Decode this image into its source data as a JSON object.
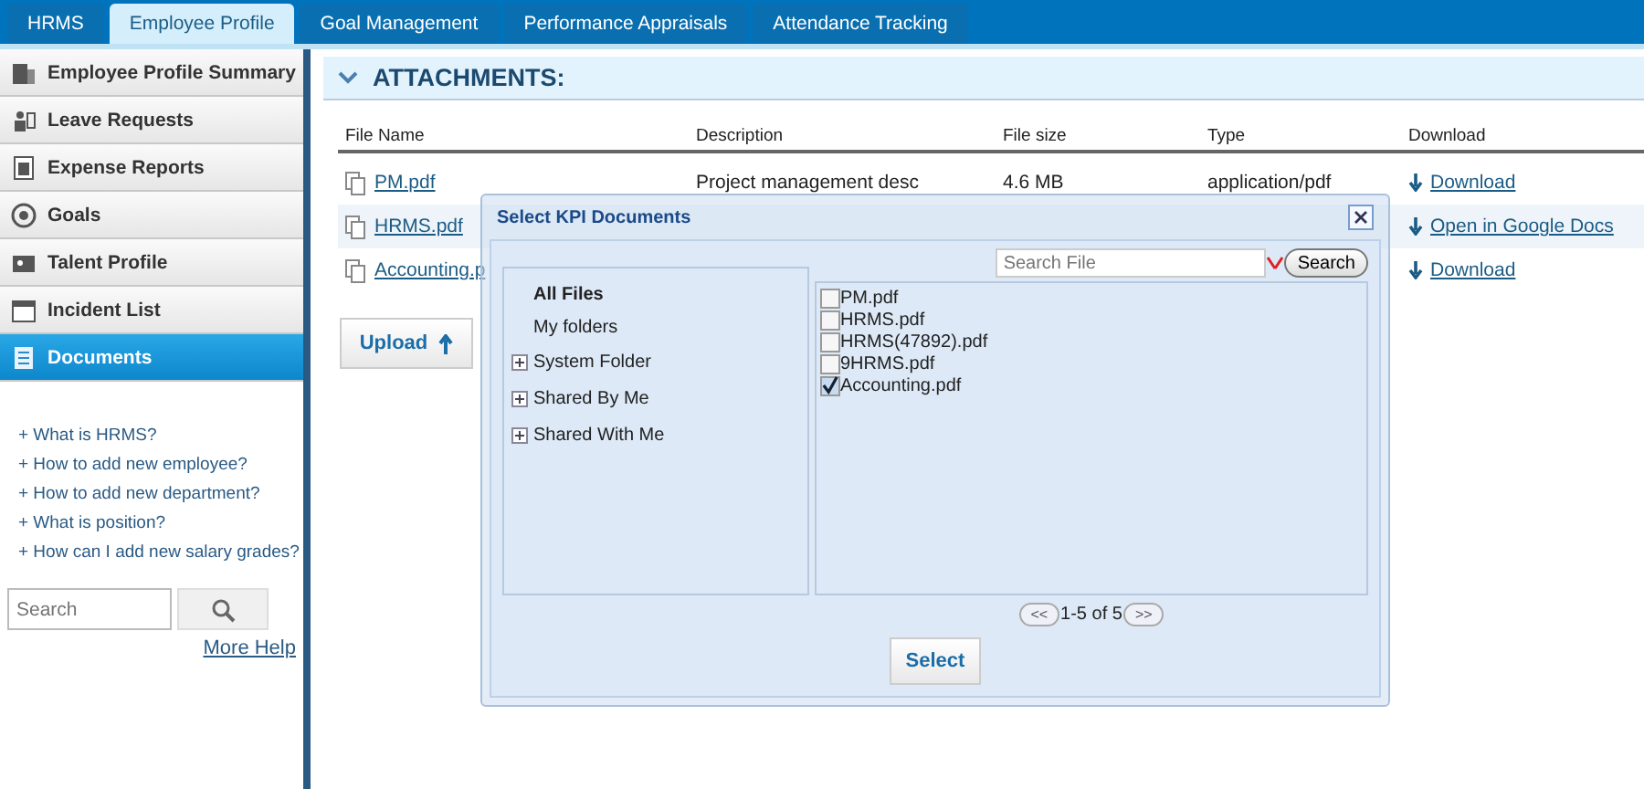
{
  "tabs": [
    {
      "label": "HRMS",
      "selected": false
    },
    {
      "label": "Employee Profile",
      "selected": true
    },
    {
      "label": "Goal Management",
      "selected": false
    },
    {
      "label": "Performance Appraisals",
      "selected": false
    },
    {
      "label": "Attendance Tracking",
      "selected": false
    }
  ],
  "sidebar": {
    "items": [
      {
        "label": "Employee Profile Summary",
        "selected": false
      },
      {
        "label": "Leave Requests",
        "selected": false
      },
      {
        "label": "Expense Reports",
        "selected": false
      },
      {
        "label": "Goals",
        "selected": false
      },
      {
        "label": "Talent Profile",
        "selected": false
      },
      {
        "label": "Incident List",
        "selected": false
      },
      {
        "label": "Documents",
        "selected": true
      }
    ],
    "help_links": [
      "+ What is HRMS?",
      "+ How to add new employee?",
      "+ How to add new department?",
      "+ What is position?",
      "+ How can I add new salary grades?"
    ],
    "search": {
      "placeholder": "Search"
    },
    "more_help": "More Help"
  },
  "section": {
    "title": "ATTACHMENTS:",
    "expanded": true
  },
  "table": {
    "columns": [
      "File Name",
      "Description",
      "File size",
      "Type",
      "Download"
    ],
    "rows": [
      {
        "file": "PM.pdf",
        "description": "Project management desc",
        "size": "4.6 MB",
        "type": "application/pdf",
        "action": "Download"
      },
      {
        "file": "HRMS.pdf",
        "action": "Open in Google Docs"
      },
      {
        "file": "Accounting.p",
        "action": "Download"
      }
    ]
  },
  "upload_button": "Upload",
  "dialog": {
    "title": "Select KPI Documents",
    "folders": [
      {
        "label": "All Files",
        "selected": true,
        "expandable": false
      },
      {
        "label": "My folders",
        "selected": false,
        "expandable": false
      },
      {
        "label": "System Folder",
        "selected": false,
        "expandable": true
      },
      {
        "label": "Shared By Me",
        "selected": false,
        "expandable": true
      },
      {
        "label": "Shared With Me",
        "selected": false,
        "expandable": true
      }
    ],
    "search": {
      "placeholder": "Search File",
      "button": "Search"
    },
    "files": [
      {
        "name": "PM.pdf",
        "checked": false
      },
      {
        "name": "HRMS.pdf",
        "checked": false
      },
      {
        "name": "HRMS(47892).pdf",
        "checked": false
      },
      {
        "name": "9HRMS.pdf",
        "checked": false
      },
      {
        "name": "Accounting.pdf",
        "checked": true
      }
    ],
    "pager": {
      "prev": "<<",
      "range": "1-5 of 5",
      "next": ">>"
    },
    "select_button": "Select"
  }
}
